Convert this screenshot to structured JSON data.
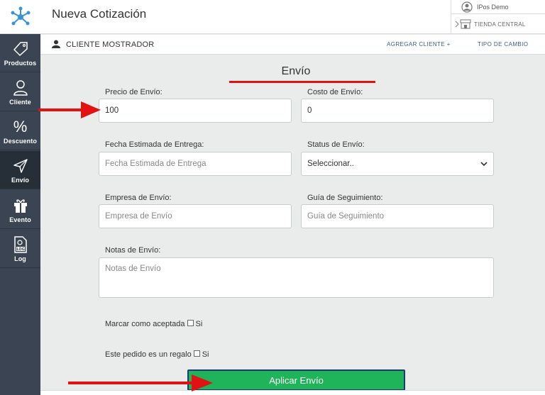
{
  "header": {
    "title": "Nueva Cotización",
    "user_name": "IPos Demo",
    "store_name": "TIENDA CENTRAL"
  },
  "subheader": {
    "client": "CLIENTE MOSTRADOR",
    "add_client": "AGREGAR CLIENTE +",
    "exchange_rate": "TIPO DE CAMBIO"
  },
  "sidebar": {
    "items": [
      {
        "label": "Productos",
        "icon": "tag-icon"
      },
      {
        "label": "Cliente",
        "icon": "user-icon"
      },
      {
        "label": "Descuento",
        "icon": "percent-icon",
        "glyph": "%"
      },
      {
        "label": "Envío",
        "icon": "paper-plane-icon"
      },
      {
        "label": "Evento",
        "icon": "gift-icon"
      },
      {
        "label": "Log",
        "icon": "log-file-icon",
        "badge": "LOG"
      }
    ]
  },
  "form": {
    "title": "Envío",
    "shipping_price": {
      "label": "Precio de Envío:",
      "value": "100"
    },
    "shipping_cost": {
      "label": "Costo de Envío:",
      "value": "0"
    },
    "delivery_date": {
      "label": "Fecha Estimada de Entrega:",
      "placeholder": "Fecha Estimada de Entrega"
    },
    "shipping_status": {
      "label": "Status de Envío:",
      "selected": "Seleccionar.."
    },
    "shipping_company": {
      "label": "Empresa de Envío:",
      "placeholder": "Empresa de Envío"
    },
    "tracking": {
      "label": "Guía de Seguimiento:",
      "placeholder": "Guía de Seguimiento"
    },
    "notes": {
      "label": "Notas de Envío:",
      "placeholder": "Notas de Envío"
    },
    "mark_accepted": {
      "label": "Marcar como aceptada",
      "option": "Si"
    },
    "gift": {
      "label": "Este pedido es un regalo",
      "option": "Si"
    },
    "apply_button": "Aplicar Envío"
  },
  "colors": {
    "sidebar_bg": "#3a4452",
    "accent_green": "#1fb35a",
    "annotation_red": "#e01212",
    "link_blue": "#3a5f8a"
  }
}
